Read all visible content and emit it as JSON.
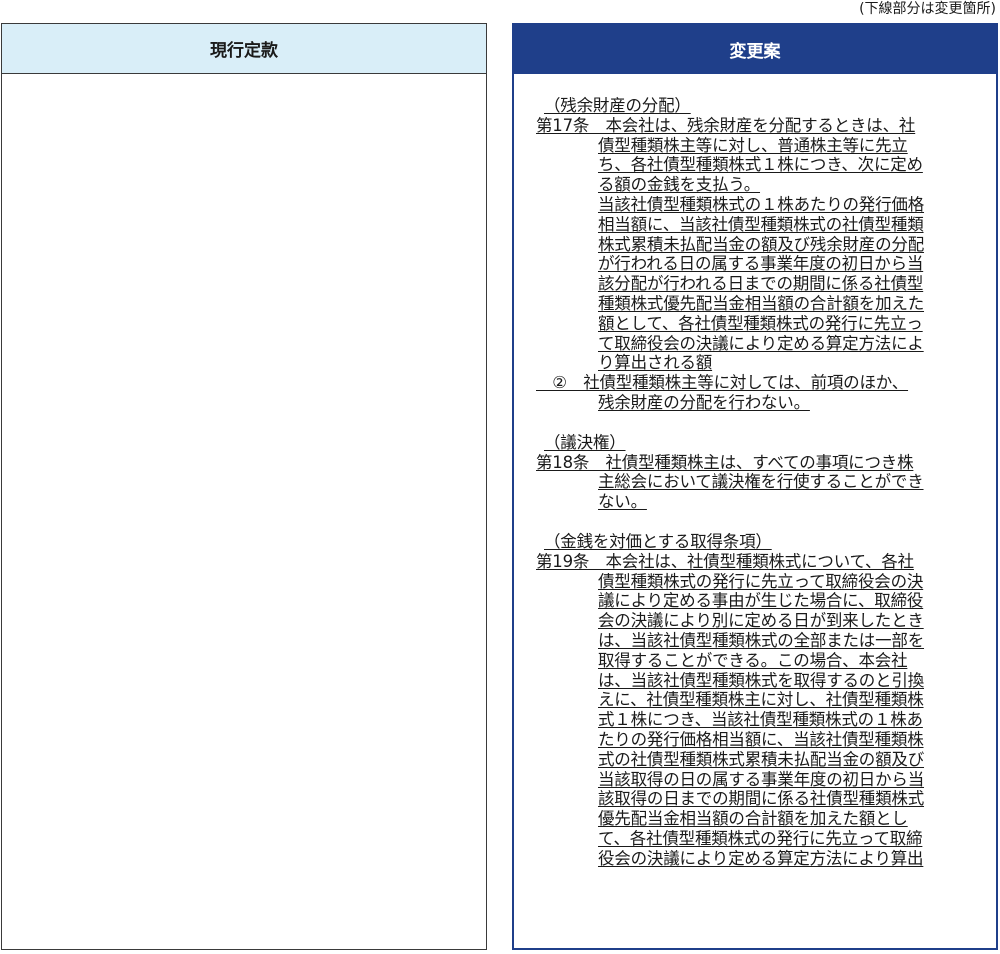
{
  "note": "(下線部分は変更箇所)",
  "left": {
    "header": "現行定款"
  },
  "right": {
    "header": "変更案",
    "lines": [
      {
        "t": "（残余財産の分配）",
        "k": "h"
      },
      {
        "t": "第17条　本会社は、残余財産を分配するときは、社",
        "k": "f"
      },
      {
        "t": "債型種類株主等に対し、普通株主等に先立",
        "k": "i"
      },
      {
        "t": "ち、各社債型種類株式１株につき、次に定め",
        "k": "i"
      },
      {
        "t": "る額の金銭を支払う。",
        "k": "i"
      },
      {
        "t": "当該社債型種類株式の１株あたりの発行価格",
        "k": "i"
      },
      {
        "t": "相当額に、当該社債型種類株式の社債型種類",
        "k": "i"
      },
      {
        "t": "株式累積未払配当金の額及び残余財産の分配",
        "k": "i"
      },
      {
        "t": "が行われる日の属する事業年度の初日から当",
        "k": "i"
      },
      {
        "t": "該分配が行われる日までの期間に係る社債型",
        "k": "i"
      },
      {
        "t": "種類株式優先配当金相当額の合計額を加えた",
        "k": "i"
      },
      {
        "t": "額として、各社債型種類株式の発行に先立っ",
        "k": "i"
      },
      {
        "t": "て取締役会の決議により定める算定方法によ",
        "k": "i"
      },
      {
        "t": "り算出される額",
        "k": "i"
      },
      {
        "t": "　②　社債型種類株主等に対しては、前項のほか、",
        "k": "f"
      },
      {
        "t": "残余財産の分配を行わない。",
        "k": "i"
      },
      {
        "t": "",
        "k": "gap"
      },
      {
        "t": "（議決権）",
        "k": "h"
      },
      {
        "t": "第18条　社債型種類株主は、すべての事項につき株",
        "k": "f"
      },
      {
        "t": "主総会において議決権を行使することができ",
        "k": "i"
      },
      {
        "t": "ない。",
        "k": "i"
      },
      {
        "t": "",
        "k": "gap"
      },
      {
        "t": "（金銭を対価とする取得条項）",
        "k": "h"
      },
      {
        "t": "第19条　本会社は、社債型種類株式について、各社",
        "k": "f"
      },
      {
        "t": "債型種類株式の発行に先立って取締役会の決",
        "k": "i"
      },
      {
        "t": "議により定める事由が生じた場合に、取締役",
        "k": "i"
      },
      {
        "t": "会の決議により別に定める日が到来したとき",
        "k": "i"
      },
      {
        "t": "は、当該社債型種類株式の全部または一部を",
        "k": "i"
      },
      {
        "t": "取得することができる。この場合、本会社",
        "k": "i"
      },
      {
        "t": "は、当該社債型種類株式を取得するのと引換",
        "k": "i"
      },
      {
        "t": "えに、社債型種類株主に対し、社債型種類株",
        "k": "i"
      },
      {
        "t": "式１株につき、当該社債型種類株式の１株あ",
        "k": "i"
      },
      {
        "t": "たりの発行価格相当額に、当該社債型種類株",
        "k": "i"
      },
      {
        "t": "式の社債型種類株式累積未払配当金の額及び",
        "k": "i"
      },
      {
        "t": "当該取得の日の属する事業年度の初日から当",
        "k": "i"
      },
      {
        "t": "該取得の日までの期間に係る社債型種類株式",
        "k": "i"
      },
      {
        "t": "優先配当金相当額の合計額を加えた額とし",
        "k": "i"
      },
      {
        "t": "て、各社債型種類株式の発行に先立って取締",
        "k": "i"
      },
      {
        "t": "役会の決議により定める算定方法により算出",
        "k": "i"
      }
    ]
  }
}
